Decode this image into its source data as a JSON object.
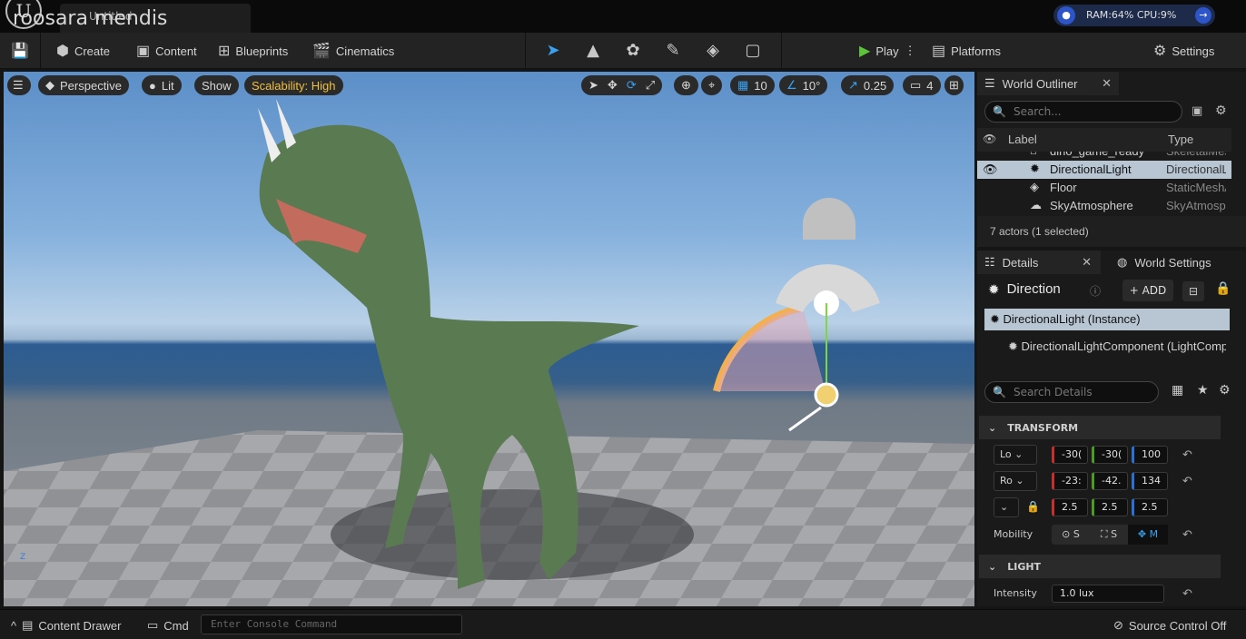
{
  "app": {
    "title": "Untitled",
    "user": "roosara mendis",
    "logo": "U",
    "perf": "RAM:64% CPU:9%"
  },
  "toolbar": {
    "create": "Create",
    "content": "Content",
    "blueprints": "Blueprints",
    "cinematics": "Cinematics",
    "play": "Play",
    "platforms": "Platforms",
    "settings": "Settings"
  },
  "viewport": {
    "perspective": "Perspective",
    "lit": "Lit",
    "show": "Show",
    "scalability": "Scalability: High",
    "grid": "10",
    "angle": "10°",
    "scale": "0.25",
    "camera_speed": "4",
    "axis_z": "Z"
  },
  "outliner": {
    "tab": "World Outliner",
    "search_placeholder": "Search...",
    "col_label": "Label",
    "col_type": "Type",
    "rows": [
      {
        "label": "dino_game_ready",
        "type": "SkeletalMesh",
        "icon": "skeletal-mesh-icon"
      },
      {
        "label": "DirectionalLight",
        "type": "DirectionalLight",
        "icon": "sun-icon",
        "selected": true
      },
      {
        "label": "Floor",
        "type": "StaticMeshActor",
        "icon": "cube-icon"
      },
      {
        "label": "SkyAtmosphere",
        "type": "SkyAtmosphere",
        "icon": "sky-icon"
      }
    ],
    "footer": "7 actors (1 selected)"
  },
  "details": {
    "tab": "Details",
    "tab2": "World Settings",
    "name": "Direction",
    "add": "ADD",
    "instance": "DirectionalLight (Instance)",
    "component": "DirectionalLightComponent (LightComp",
    "search_placeholder": "Search Details",
    "transform": "TRANSFORM",
    "loc_label": "Lo",
    "rot_label": "Ro",
    "loc": [
      "-30(",
      "-30(",
      "100"
    ],
    "rot": [
      "-23:",
      "-42.",
      "134"
    ],
    "scale": [
      "2.5",
      "2.5",
      "2.5"
    ],
    "mobility_label": "Mobility",
    "mob": [
      "S",
      "S",
      "M"
    ],
    "light": "LIGHT",
    "intensity_label": "Intensity",
    "intensity": "1.0 lux"
  },
  "status": {
    "content_drawer": "Content Drawer",
    "cmd": "Cmd",
    "console_placeholder": "Enter Console Command",
    "source_control": "Source Control Off"
  }
}
